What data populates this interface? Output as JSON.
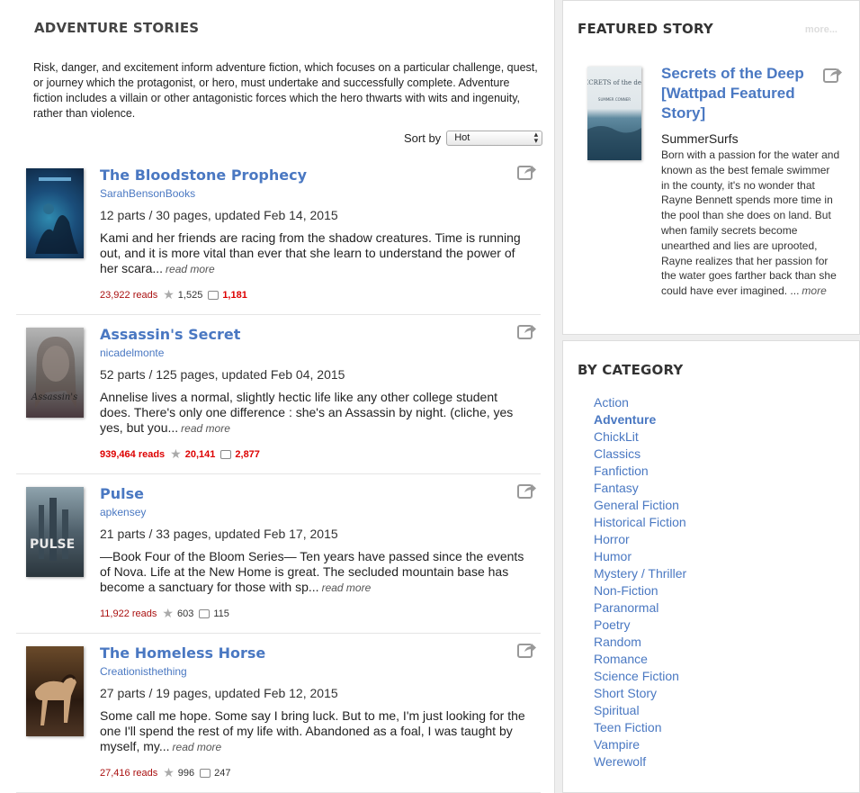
{
  "main": {
    "title": "ADVENTURE STORIES",
    "description": "Risk, danger, and excitement inform adventure fiction, which focuses on a particular challenge, quest, or journey which the protagonist, or hero, must undertake and successfully complete. Adventure fiction includes a villain or other antagonistic forces which the hero thwarts with wits and ingenuity, rather than violence.",
    "sort_label": "Sort by",
    "sort_value": "Hot"
  },
  "stories": [
    {
      "title": "The Bloodstone Prophecy",
      "author": "SarahBensonBooks",
      "parts": "12 parts / 30 pages, updated Feb 14, 2015",
      "desc": "Kami and her friends are racing from the shadow creatures. Time is running out, and it is more vital than ever that she learn to understand the power of her scara...",
      "more": "read more",
      "reads": "23,922 reads",
      "votes": "1,525",
      "comments": "1,181"
    },
    {
      "title": "Assassin's Secret",
      "author": "nicadelmonte",
      "parts": "52 parts / 125 pages, updated Feb 04, 2015",
      "desc": "Annelise lives a normal, slightly hectic life like any other college student does. There's only one difference : she's an Assassin by night. (cliche, yes yes, but you...",
      "more": "read more",
      "reads": "939,464 reads",
      "votes": "20,141",
      "comments": "2,877"
    },
    {
      "title": "Pulse",
      "author": "apkensey",
      "parts": "21 parts / 33 pages, updated Feb 17, 2015",
      "desc": "—Book Four of the Bloom Series— Ten years have passed since the events of Nova. Life at the New Home is great. The secluded mountain base has become a sanctuary for those with sp...",
      "more": "read more",
      "reads": "11,922 reads",
      "votes": "603",
      "comments": "115"
    },
    {
      "title": "The Homeless Horse",
      "author": "Creationisthething",
      "parts": "27 parts / 19 pages, updated Feb 12, 2015",
      "desc": "Some call me hope. Some say I bring luck. But to me, I'm just looking for the one I'll spend the rest of my life with. Abandoned as a foal, I was taught by myself, my...",
      "more": "read more",
      "reads": "27,416 reads",
      "votes": "996",
      "comments": "247"
    }
  ],
  "featured": {
    "heading": "FEATURED STORY",
    "more_link": "more...",
    "title": "Secrets of the Deep [Wattpad Featured Story]",
    "author": "SummerSurfs",
    "desc": "Born with a passion for the water and known as the best female swimmer in the county, it's no wonder that Rayne Bennett spends more time in the pool than she does on land. But when family secrets become unearthed and lies are uprooted, Rayne realizes that her passion for the water goes farther back than she could have ever imagined. ...",
    "more": "more",
    "cover_text": {
      "title": "SECRETS of the deep",
      "author": "SUMMER CONNER"
    }
  },
  "category": {
    "heading": "BY CATEGORY",
    "items": [
      "Action",
      "Adventure",
      "ChickLit",
      "Classics",
      "Fanfiction",
      "Fantasy",
      "General Fiction",
      "Historical Fiction",
      "Horror",
      "Humor",
      "Mystery / Thriller",
      "Non-Fiction",
      "Paranormal",
      "Poetry",
      "Random",
      "Romance",
      "Science Fiction",
      "Short Story",
      "Spiritual",
      "Teen Fiction",
      "Vampire",
      "Werewolf"
    ],
    "active": "Adventure"
  },
  "colors": {
    "link": "#4a78c2",
    "reads": "#aa1111",
    "hot": "#dd0000"
  },
  "icons": [
    "share-icon",
    "star-icon",
    "comment-icon",
    "sort-arrows-icon"
  ]
}
